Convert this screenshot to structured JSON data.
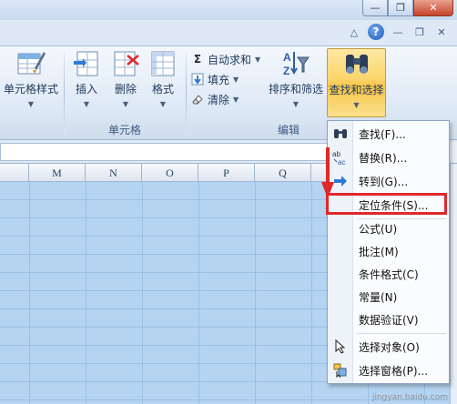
{
  "ribbon": {
    "cell_style": "单元格样式",
    "insert": "插入",
    "delete": "删除",
    "format": "格式",
    "cells_group": "单元格",
    "autosum": "自动求和",
    "fill": "填充",
    "clear": "清除",
    "sort_filter": "排序和筛选",
    "find_select": "查找和选择",
    "edit_group": "编辑"
  },
  "columns": [
    "M",
    "N",
    "O",
    "P",
    "Q"
  ],
  "menu": {
    "items": [
      {
        "label": "查找(F)...",
        "icon": "binoculars-icon"
      },
      {
        "label": "替换(R)...",
        "icon": "replace-icon"
      },
      {
        "label": "转到(G)...",
        "icon": "goto-arrow-icon"
      },
      {
        "label": "定位条件(S)...",
        "icon": ""
      },
      {
        "label": "公式(U)",
        "icon": ""
      },
      {
        "label": "批注(M)",
        "icon": ""
      },
      {
        "label": "条件格式(C)",
        "icon": ""
      },
      {
        "label": "常量(N)",
        "icon": ""
      },
      {
        "label": "数据验证(V)",
        "icon": ""
      },
      {
        "label": "选择对象(O)",
        "icon": "cursor-icon"
      },
      {
        "label": "选择窗格(P)...",
        "icon": "selection-pane-icon"
      }
    ]
  },
  "colors": {
    "accent_highlight": "#e0282b",
    "active_button": "#fbd56a",
    "selection_fill": "#b5d4f1"
  },
  "watermark": "jingyan.baidu.com"
}
